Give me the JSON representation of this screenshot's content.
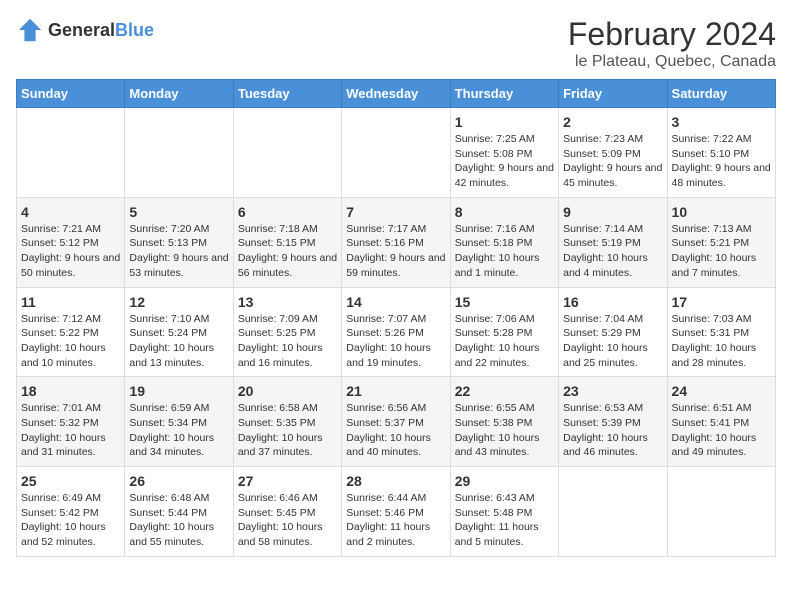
{
  "logo": {
    "text_general": "General",
    "text_blue": "Blue"
  },
  "title": "February 2024",
  "subtitle": "le Plateau, Quebec, Canada",
  "days_of_week": [
    "Sunday",
    "Monday",
    "Tuesday",
    "Wednesday",
    "Thursday",
    "Friday",
    "Saturday"
  ],
  "weeks": [
    [
      {
        "day": "",
        "info": ""
      },
      {
        "day": "",
        "info": ""
      },
      {
        "day": "",
        "info": ""
      },
      {
        "day": "",
        "info": ""
      },
      {
        "day": "1",
        "info": "Sunrise: 7:25 AM\nSunset: 5:08 PM\nDaylight: 9 hours\nand 42 minutes."
      },
      {
        "day": "2",
        "info": "Sunrise: 7:23 AM\nSunset: 5:09 PM\nDaylight: 9 hours\nand 45 minutes."
      },
      {
        "day": "3",
        "info": "Sunrise: 7:22 AM\nSunset: 5:10 PM\nDaylight: 9 hours\nand 48 minutes."
      }
    ],
    [
      {
        "day": "4",
        "info": "Sunrise: 7:21 AM\nSunset: 5:12 PM\nDaylight: 9 hours\nand 50 minutes."
      },
      {
        "day": "5",
        "info": "Sunrise: 7:20 AM\nSunset: 5:13 PM\nDaylight: 9 hours\nand 53 minutes."
      },
      {
        "day": "6",
        "info": "Sunrise: 7:18 AM\nSunset: 5:15 PM\nDaylight: 9 hours\nand 56 minutes."
      },
      {
        "day": "7",
        "info": "Sunrise: 7:17 AM\nSunset: 5:16 PM\nDaylight: 9 hours\nand 59 minutes."
      },
      {
        "day": "8",
        "info": "Sunrise: 7:16 AM\nSunset: 5:18 PM\nDaylight: 10 hours\nand 1 minute."
      },
      {
        "day": "9",
        "info": "Sunrise: 7:14 AM\nSunset: 5:19 PM\nDaylight: 10 hours\nand 4 minutes."
      },
      {
        "day": "10",
        "info": "Sunrise: 7:13 AM\nSunset: 5:21 PM\nDaylight: 10 hours\nand 7 minutes."
      }
    ],
    [
      {
        "day": "11",
        "info": "Sunrise: 7:12 AM\nSunset: 5:22 PM\nDaylight: 10 hours\nand 10 minutes."
      },
      {
        "day": "12",
        "info": "Sunrise: 7:10 AM\nSunset: 5:24 PM\nDaylight: 10 hours\nand 13 minutes."
      },
      {
        "day": "13",
        "info": "Sunrise: 7:09 AM\nSunset: 5:25 PM\nDaylight: 10 hours\nand 16 minutes."
      },
      {
        "day": "14",
        "info": "Sunrise: 7:07 AM\nSunset: 5:26 PM\nDaylight: 10 hours\nand 19 minutes."
      },
      {
        "day": "15",
        "info": "Sunrise: 7:06 AM\nSunset: 5:28 PM\nDaylight: 10 hours\nand 22 minutes."
      },
      {
        "day": "16",
        "info": "Sunrise: 7:04 AM\nSunset: 5:29 PM\nDaylight: 10 hours\nand 25 minutes."
      },
      {
        "day": "17",
        "info": "Sunrise: 7:03 AM\nSunset: 5:31 PM\nDaylight: 10 hours\nand 28 minutes."
      }
    ],
    [
      {
        "day": "18",
        "info": "Sunrise: 7:01 AM\nSunset: 5:32 PM\nDaylight: 10 hours\nand 31 minutes."
      },
      {
        "day": "19",
        "info": "Sunrise: 6:59 AM\nSunset: 5:34 PM\nDaylight: 10 hours\nand 34 minutes."
      },
      {
        "day": "20",
        "info": "Sunrise: 6:58 AM\nSunset: 5:35 PM\nDaylight: 10 hours\nand 37 minutes."
      },
      {
        "day": "21",
        "info": "Sunrise: 6:56 AM\nSunset: 5:37 PM\nDaylight: 10 hours\nand 40 minutes."
      },
      {
        "day": "22",
        "info": "Sunrise: 6:55 AM\nSunset: 5:38 PM\nDaylight: 10 hours\nand 43 minutes."
      },
      {
        "day": "23",
        "info": "Sunrise: 6:53 AM\nSunset: 5:39 PM\nDaylight: 10 hours\nand 46 minutes."
      },
      {
        "day": "24",
        "info": "Sunrise: 6:51 AM\nSunset: 5:41 PM\nDaylight: 10 hours\nand 49 minutes."
      }
    ],
    [
      {
        "day": "25",
        "info": "Sunrise: 6:49 AM\nSunset: 5:42 PM\nDaylight: 10 hours\nand 52 minutes."
      },
      {
        "day": "26",
        "info": "Sunrise: 6:48 AM\nSunset: 5:44 PM\nDaylight: 10 hours\nand 55 minutes."
      },
      {
        "day": "27",
        "info": "Sunrise: 6:46 AM\nSunset: 5:45 PM\nDaylight: 10 hours\nand 58 minutes."
      },
      {
        "day": "28",
        "info": "Sunrise: 6:44 AM\nSunset: 5:46 PM\nDaylight: 11 hours\nand 2 minutes."
      },
      {
        "day": "29",
        "info": "Sunrise: 6:43 AM\nSunset: 5:48 PM\nDaylight: 11 hours\nand 5 minutes."
      },
      {
        "day": "",
        "info": ""
      },
      {
        "day": "",
        "info": ""
      }
    ]
  ]
}
